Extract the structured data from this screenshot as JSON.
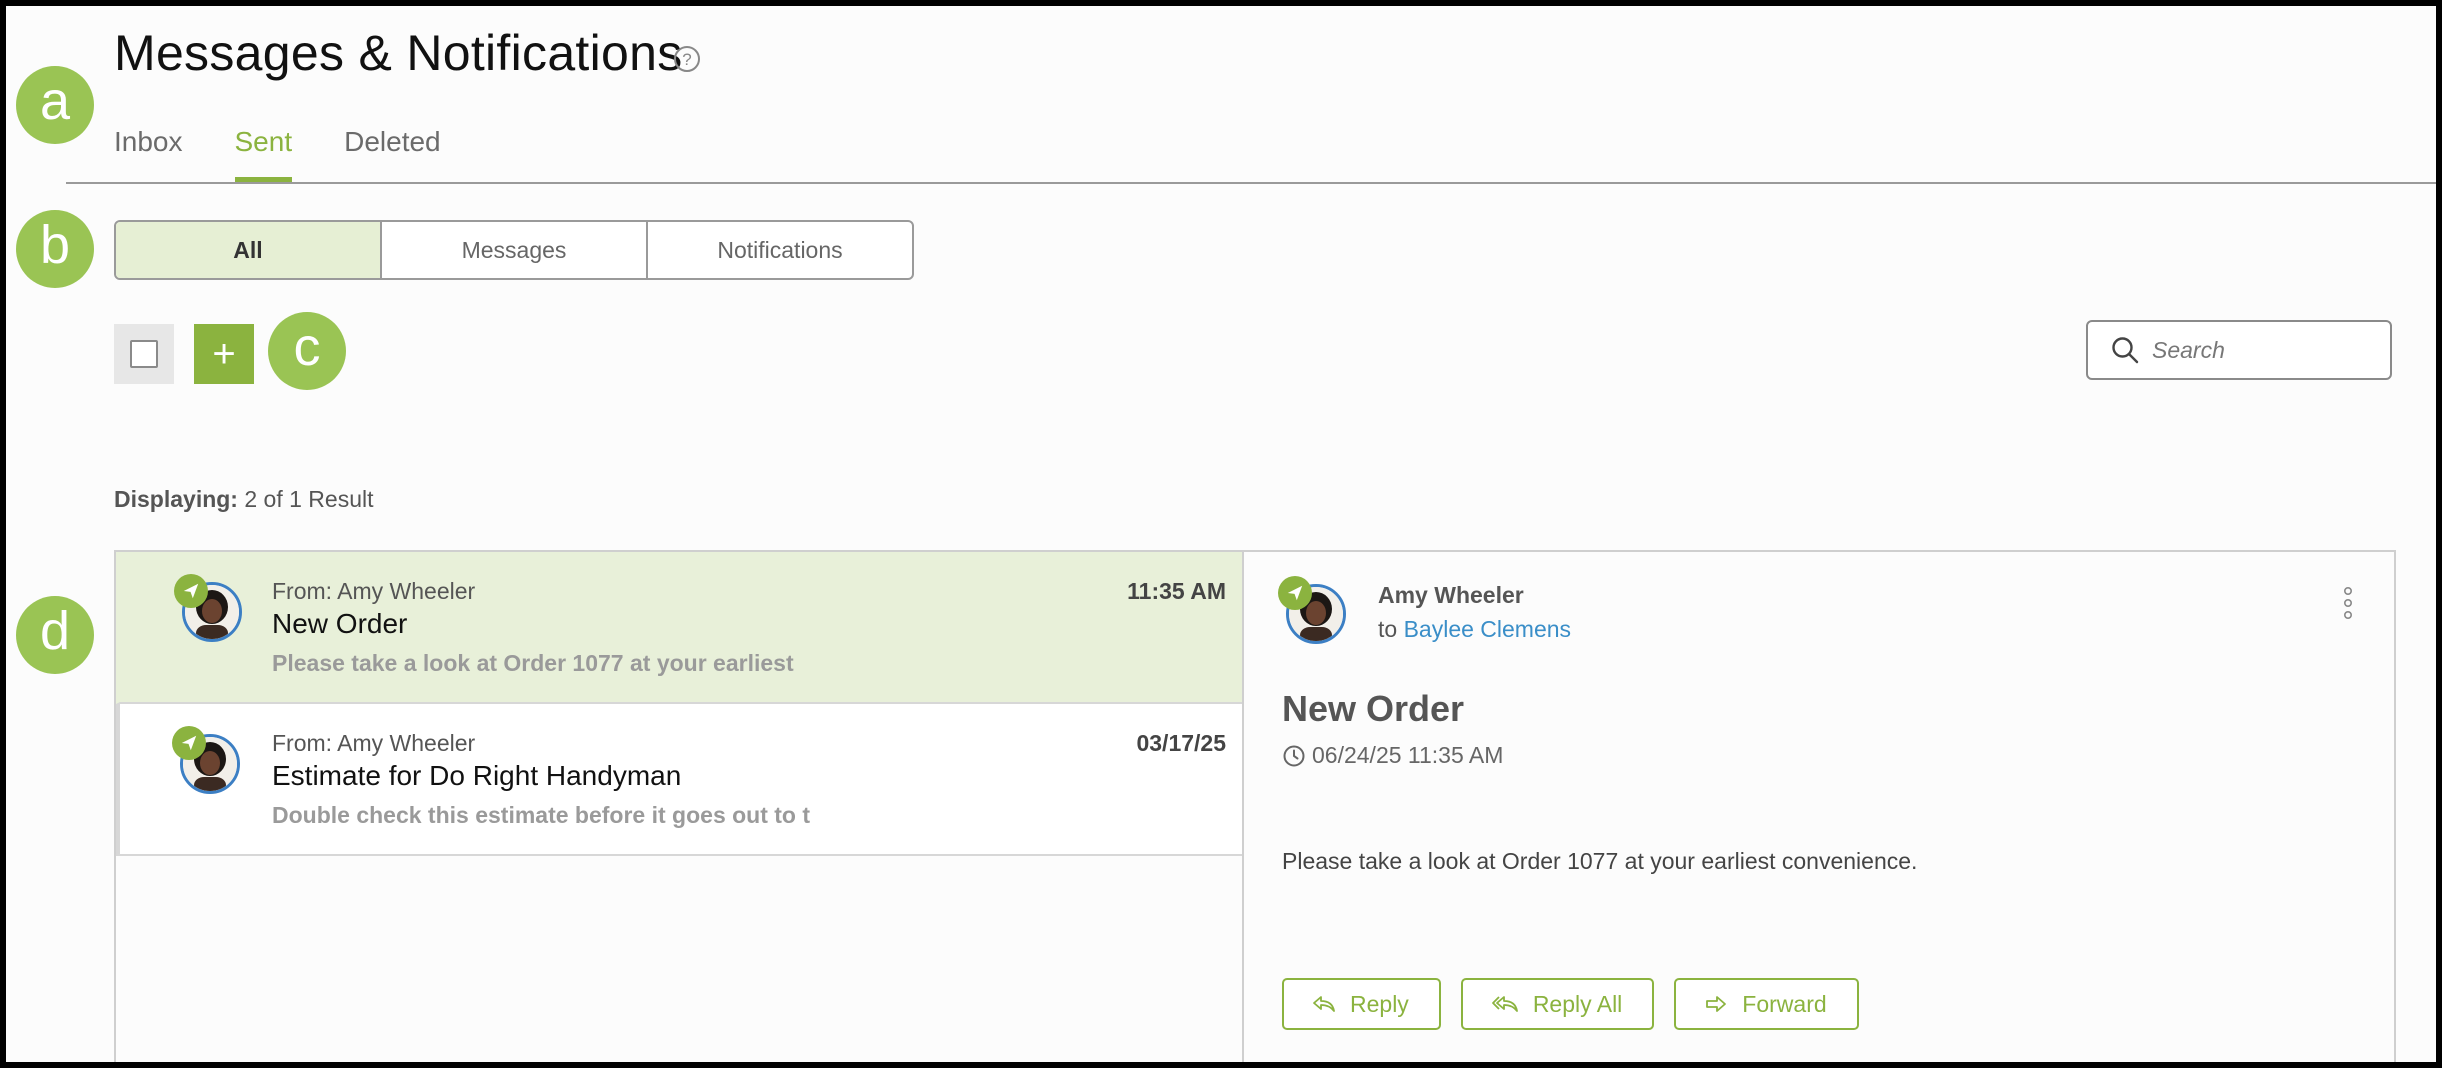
{
  "header": {
    "title": "Messages & Notifications"
  },
  "markers": {
    "a": "a",
    "b": "b",
    "c": "c",
    "d": "d"
  },
  "tabs": [
    {
      "label": "Inbox",
      "active": false
    },
    {
      "label": "Sent",
      "active": true
    },
    {
      "label": "Deleted",
      "active": false
    }
  ],
  "filter": {
    "options": [
      "All",
      "Messages",
      "Notifications"
    ],
    "selected": "All"
  },
  "toolbar": {
    "add_label": "+"
  },
  "search": {
    "placeholder": "Search",
    "value": ""
  },
  "results": {
    "label": "Displaying:",
    "text": "2 of 1 Result"
  },
  "messages": [
    {
      "from": "From: Amy Wheeler",
      "subject": "New Order",
      "preview": "Please take a look at Order 1077 at your earliest",
      "time": "11:35 AM",
      "selected": true
    },
    {
      "from": "From: Amy Wheeler",
      "subject": "Estimate for Do Right Handyman",
      "preview": "Double check this estimate before it goes out to t",
      "time": "03/17/25",
      "selected": false
    }
  ],
  "detail": {
    "sender": "Amy Wheeler",
    "to_prefix": "to",
    "recipient": "Baylee Clemens",
    "subject": "New Order",
    "datetime": "06/24/25 11:35 AM",
    "body": "Please take a look at Order 1077 at your earliest convenience.",
    "actions": {
      "reply": "Reply",
      "reply_all": "Reply All",
      "forward": "Forward"
    }
  },
  "colors": {
    "accent": "#8bb33f",
    "marker": "#9ac454",
    "selected_bg": "#e8f0d9",
    "link": "#3a8ec8"
  },
  "icons": [
    "help-icon",
    "search-icon",
    "sent-icon",
    "clock-icon",
    "kebab-icon",
    "reply-icon",
    "reply-all-icon",
    "forward-icon"
  ]
}
